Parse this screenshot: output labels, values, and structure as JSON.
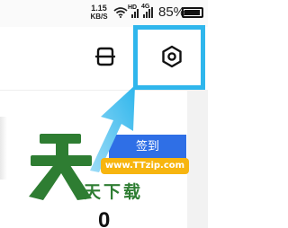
{
  "status_bar": {
    "net_speed": "1.15",
    "net_speed_unit": "KB/S",
    "signal_hd": "HD",
    "signal_4g": "4G",
    "battery_percent": "85%",
    "icons": [
      "wifi-icon",
      "signal-icon",
      "battery-icon"
    ]
  },
  "toolbar": {
    "scan_icon": "scan-icon",
    "settings_icon": "gear-icon",
    "highlight_color": "#2fb6ec"
  },
  "main": {
    "checkin_label": "签到",
    "checkin_color": "#2f6fe6",
    "count_value": "0"
  },
  "watermark": {
    "logo_char": "天",
    "url": "www.TTzip.com",
    "site_name": "天下载"
  }
}
